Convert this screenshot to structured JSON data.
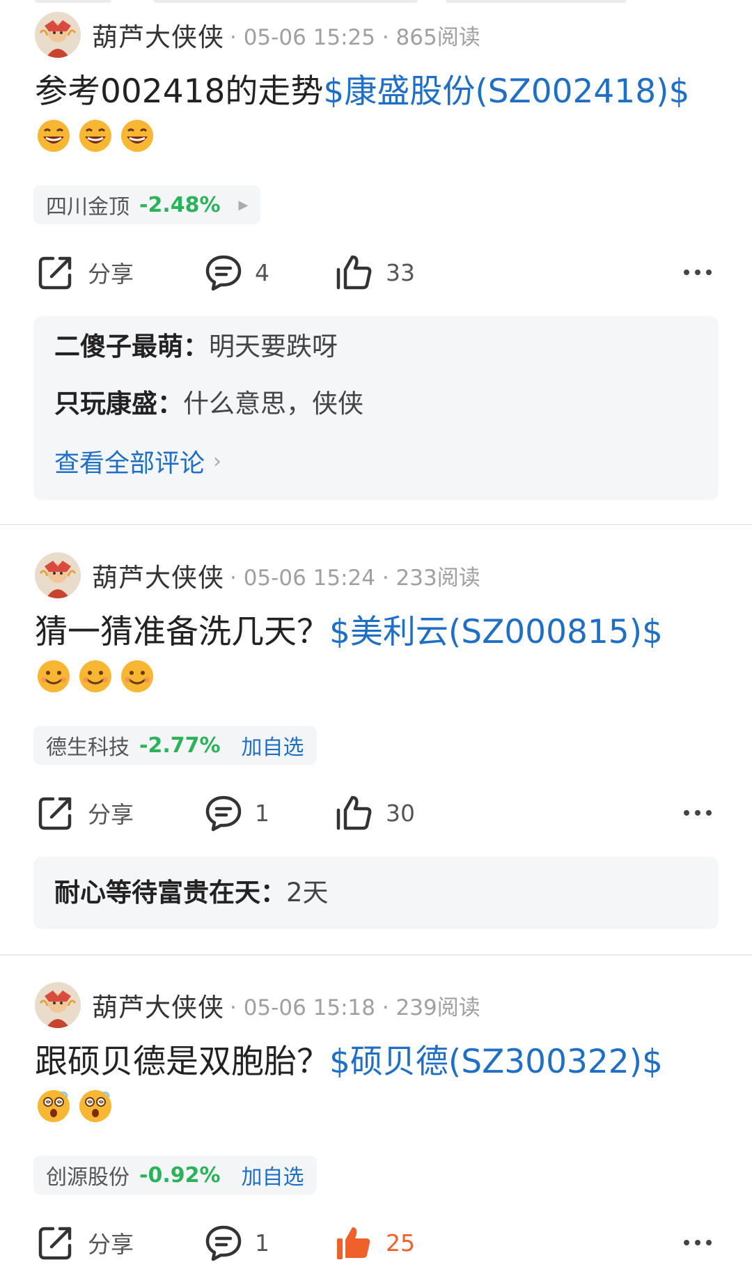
{
  "posts": [
    {
      "user": "葫芦大侠侠",
      "meta": "· 05-06 15:25 · 865阅读",
      "text": "参考002418的走势",
      "stock_link": "$康盛股份(SZ002418)$",
      "emoji": "laugh-emoji",
      "tag": {
        "name": "四川金顶",
        "change": "-2.48%",
        "add": ""
      },
      "share_label": "分享",
      "comment_count": "4",
      "like_count": "33",
      "comments": [
        {
          "author": "二傻子最萌：",
          "text": "明天要跌呀"
        },
        {
          "author": "只玩康盛：",
          "text": "什么意思，侠侠"
        }
      ],
      "view_all": "查看全部评论"
    },
    {
      "user": "葫芦大侠侠",
      "meta": "· 05-06 15:24 · 233阅读",
      "text": "猜一猜准备洗几天？",
      "stock_link": "$美利云(SZ000815)$",
      "emoji": "smile-emoji",
      "tag": {
        "name": "德生科技",
        "change": "-2.77%",
        "add": "加自选"
      },
      "share_label": "分享",
      "comment_count": "1",
      "like_count": "30",
      "comments": [
        {
          "author": "耐心等待富贵在天：",
          "text": "2天"
        }
      ]
    },
    {
      "user": "葫芦大侠侠",
      "meta": "· 05-06 15:18 · 239阅读",
      "text": "跟硕贝德是双胞胎？",
      "stock_link": "$硕贝德(SZ300322)$",
      "emoji": "dizzy-emoji",
      "tag": {
        "name": "创源股份",
        "change": "-0.92%",
        "add": "加自选"
      },
      "share_label": "分享",
      "comment_count": "1",
      "like_count": "25"
    }
  ],
  "colors": {
    "link": "#1f6fc4",
    "down": "#2bb25a",
    "liked": "#f0602a"
  }
}
